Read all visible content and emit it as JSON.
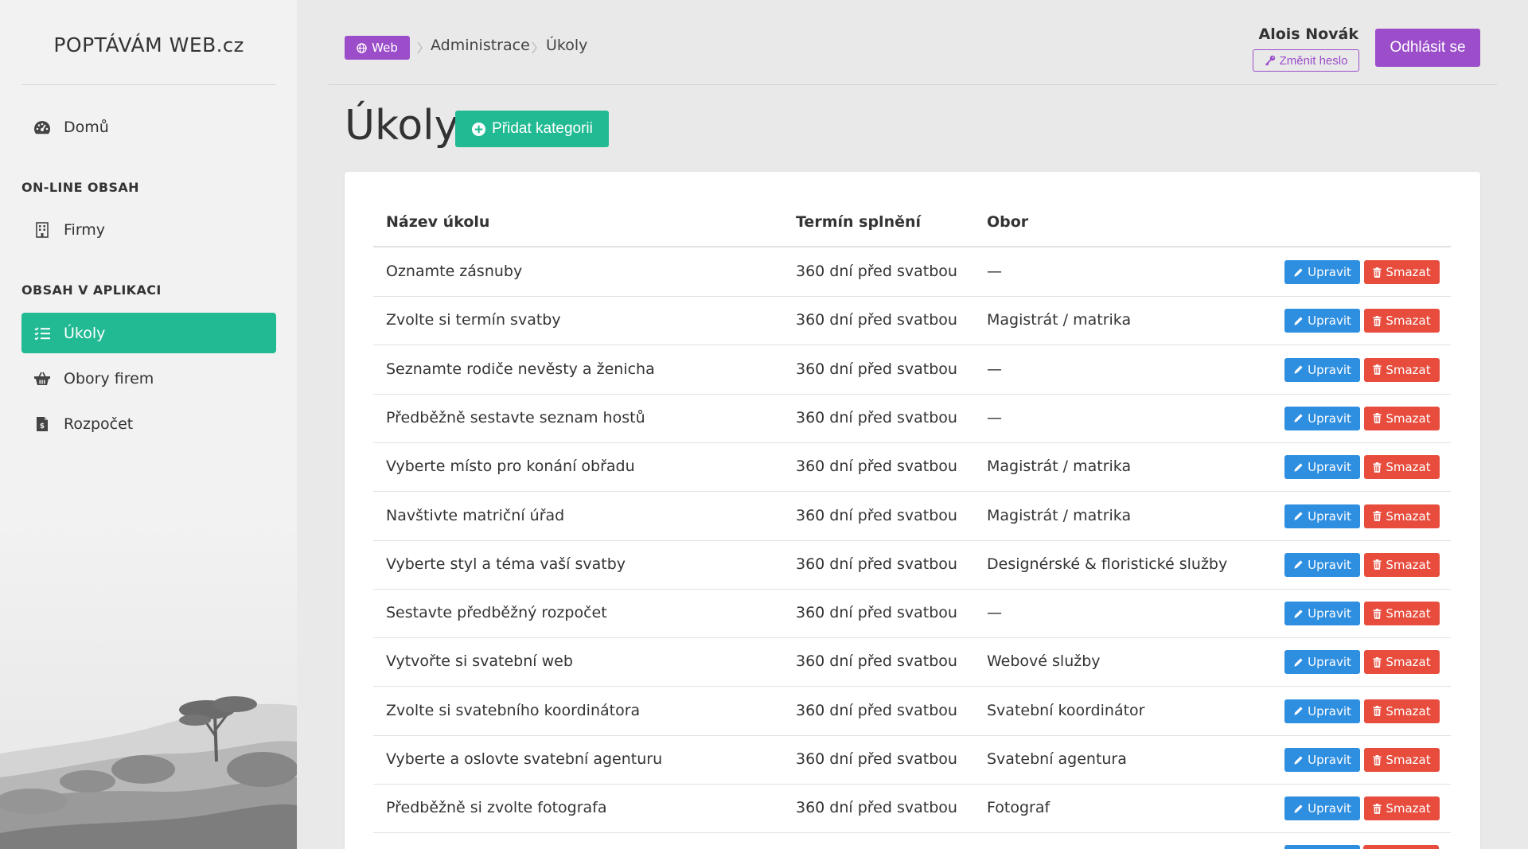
{
  "brand": {
    "name": "POPTÁVÁM WEB",
    "tld": ".cz"
  },
  "sidebar": {
    "home": {
      "label": "Domů",
      "icon": "dashboard-icon"
    },
    "section_online": "ON-LINE OBSAH",
    "firms": {
      "label": "Firmy",
      "icon": "building-icon"
    },
    "section_app": "OBSAH V APLIKACI",
    "items": [
      {
        "label": "Úkoly",
        "icon": "tasks-icon",
        "active": true
      },
      {
        "label": "Obory firem",
        "icon": "basket-icon",
        "active": false
      },
      {
        "label": "Rozpočet",
        "icon": "invoice-icon",
        "active": false
      }
    ]
  },
  "breadcrumb": {
    "web": "Web",
    "admin": "Administrace",
    "current": "Úkoly"
  },
  "user": {
    "name": "Alois Novák",
    "change_password": "Změnit heslo",
    "logout": "Odhlásit se"
  },
  "page": {
    "title": "Úkoly",
    "add_button": "Přidat kategorii"
  },
  "table": {
    "headers": [
      "Název úkolu",
      "Termín splnění",
      "Obor"
    ],
    "edit_label": "Upravit",
    "delete_label": "Smazat",
    "rows": [
      {
        "name": "Oznamte zásnuby",
        "term": "360 dní před svatbou",
        "field": "—"
      },
      {
        "name": "Zvolte si termín svatby",
        "term": "360 dní před svatbou",
        "field": "Magistrát / matrika"
      },
      {
        "name": "Seznamte rodiče nevěsty a ženicha",
        "term": "360 dní před svatbou",
        "field": "—"
      },
      {
        "name": "Předběžně sestavte seznam hostů",
        "term": "360 dní před svatbou",
        "field": "—"
      },
      {
        "name": "Vyberte místo pro konání obřadu",
        "term": "360 dní před svatbou",
        "field": "Magistrát / matrika"
      },
      {
        "name": "Navštivte matriční úřad",
        "term": "360 dní před svatbou",
        "field": "Magistrát / matrika"
      },
      {
        "name": "Vyberte styl a téma vaší svatby",
        "term": "360 dní před svatbou",
        "field": "Designérské & floristické služby"
      },
      {
        "name": "Sestavte předběžný rozpočet",
        "term": "360 dní před svatbou",
        "field": "—"
      },
      {
        "name": "Vytvořte si svatební web",
        "term": "360 dní před svatbou",
        "field": "Webové služby"
      },
      {
        "name": "Zvolte si svatebního koordinátora",
        "term": "360 dní před svatbou",
        "field": "Svatební koordinátor"
      },
      {
        "name": "Vyberte a oslovte svatební agenturu",
        "term": "360 dní před svatbou",
        "field": "Svatební agentura"
      },
      {
        "name": "Předběžně si zvolte fotografa",
        "term": "360 dní před svatbou",
        "field": "Fotograf"
      }
    ]
  },
  "colors": {
    "accent_green": "#21ba93",
    "accent_purple": "#9b4dca",
    "edit_blue": "#2e8ee0",
    "delete_red": "#e74c3c"
  }
}
